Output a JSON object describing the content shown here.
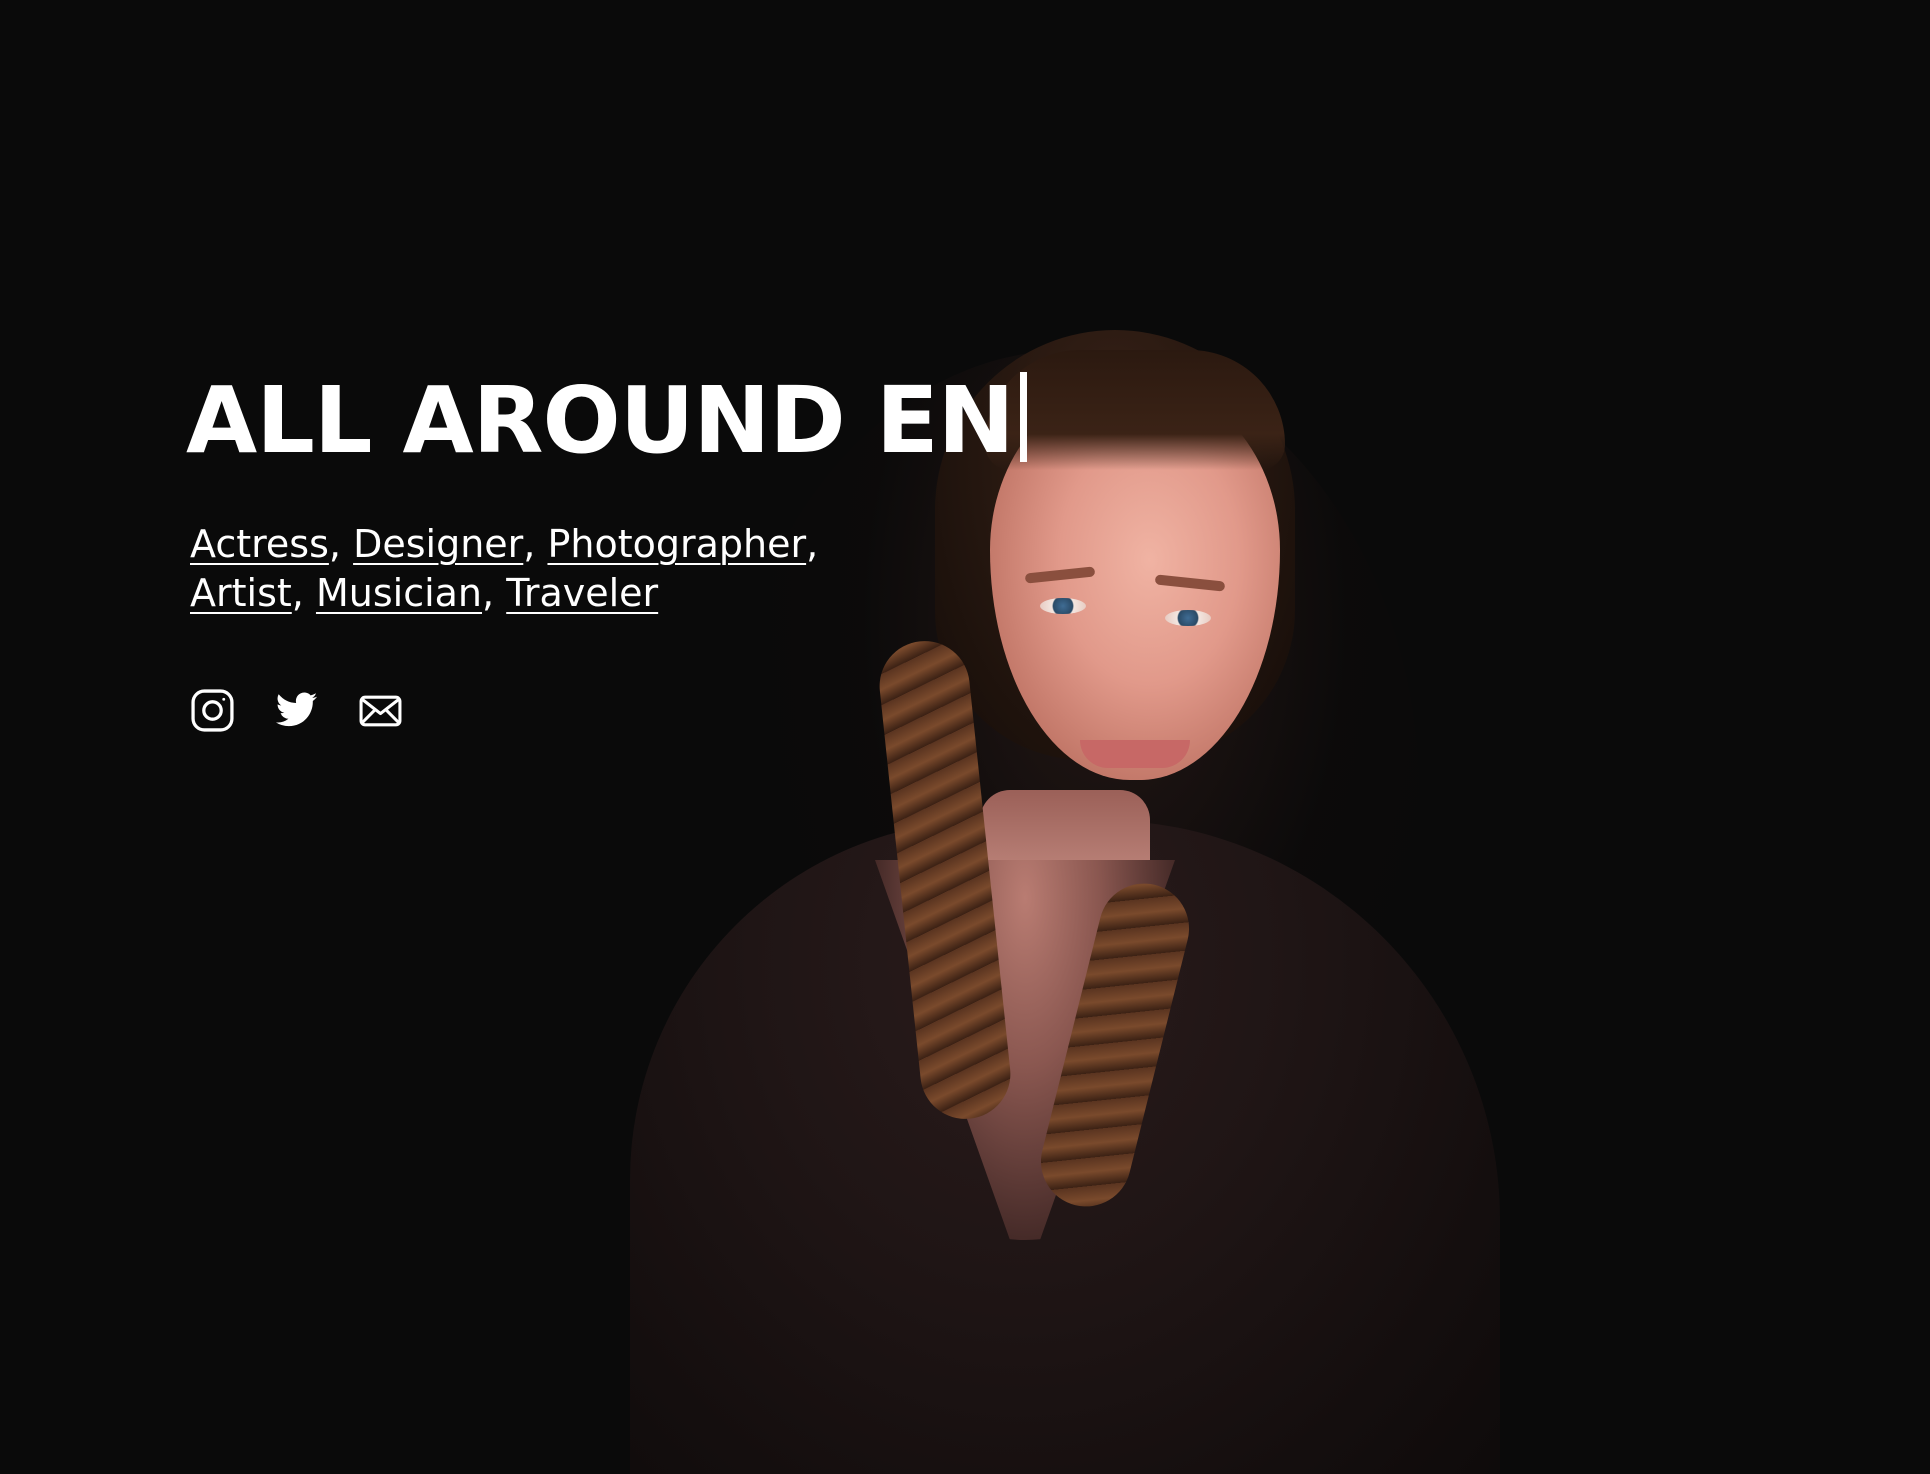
{
  "hero": {
    "title": "ALL AROUND EN"
  },
  "roles": [
    {
      "label": "Actress",
      "sep": ","
    },
    {
      "label": "Designer",
      "sep": ","
    },
    {
      "label": "Photographer",
      "sep": ","
    },
    {
      "label": "Artist",
      "sep": ","
    },
    {
      "label": "Musician",
      "sep": ","
    },
    {
      "label": "Traveler",
      "sep": ""
    }
  ],
  "social": [
    {
      "icon": "instagram-icon"
    },
    {
      "icon": "twitter-icon"
    },
    {
      "icon": "mail-icon"
    }
  ],
  "colors": {
    "background": "#0a0a0a",
    "text": "#ffffff"
  }
}
